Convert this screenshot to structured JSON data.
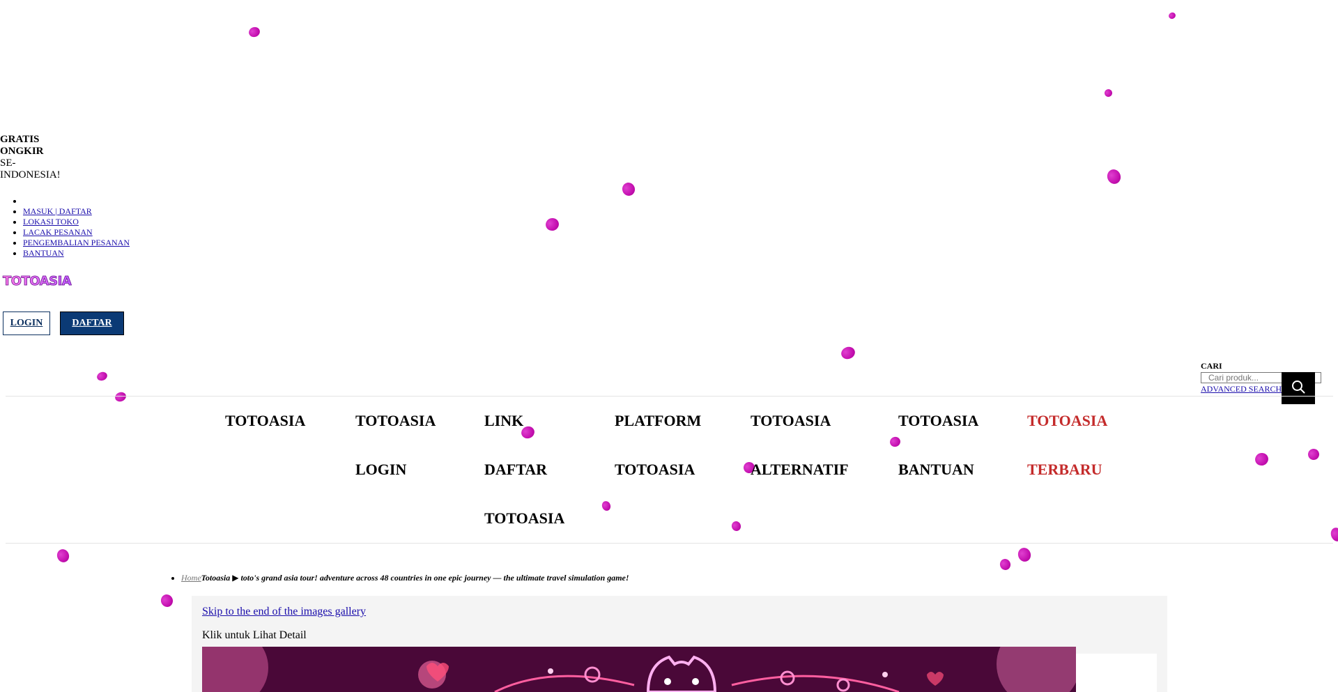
{
  "promo": {
    "line1": "GRATIS",
    "line2": "ONGKIR",
    "line3": "SE-",
    "line4": "INDONESIA!"
  },
  "top_links": [
    {
      "label": "MASUK | DAFTAR"
    },
    {
      "label": "LOKASI TOKO"
    },
    {
      "label": "LACAK PESANAN"
    },
    {
      "label": "PENGEMBALIAN PESANAN"
    },
    {
      "label": "BANTUAN"
    }
  ],
  "logo": {
    "text": "TOTOASIA"
  },
  "auth": {
    "login_label": "LOGIN",
    "daftar_label": "DAFTAR"
  },
  "search": {
    "label": "CARI",
    "placeholder": "Cari produk...",
    "advanced_label": "ADVANCED SEARCH"
  },
  "nav": {
    "items": [
      {
        "line1": "TOTOASIA",
        "line2": "",
        "line3": ""
      },
      {
        "line1": "TOTOASIA",
        "line2": "LOGIN",
        "line3": ""
      },
      {
        "line1": "LINK",
        "line2": "DAFTAR",
        "line3": "TOTOASIA"
      },
      {
        "line1": "PLATFORM",
        "line2": "TOTOASIA",
        "line3": ""
      },
      {
        "line1": "TOTOASIA",
        "line2": "ALTERNATIF",
        "line3": ""
      },
      {
        "line1": "TOTOASIA",
        "line2": "BANTUAN",
        "line3": ""
      },
      {
        "line1": "TOTOASIA",
        "line2": "TERBARU",
        "line3": ""
      }
    ],
    "highlight_color": "#c42b2b"
  },
  "breadcrumb": {
    "home": "Home",
    "current": "Totoasia ▶ toto's grand asia tour! adventure across 48 countries in one epic journey — the ultimate travel simulation game!"
  },
  "gallery": {
    "skip_label": "Skip to the end of the images gallery",
    "caption": "Klik untuk Lihat Detail"
  },
  "colors": {
    "petal": "#c410b0",
    "daftar_bg": "#0b3a75",
    "link": "#1a0dab"
  }
}
